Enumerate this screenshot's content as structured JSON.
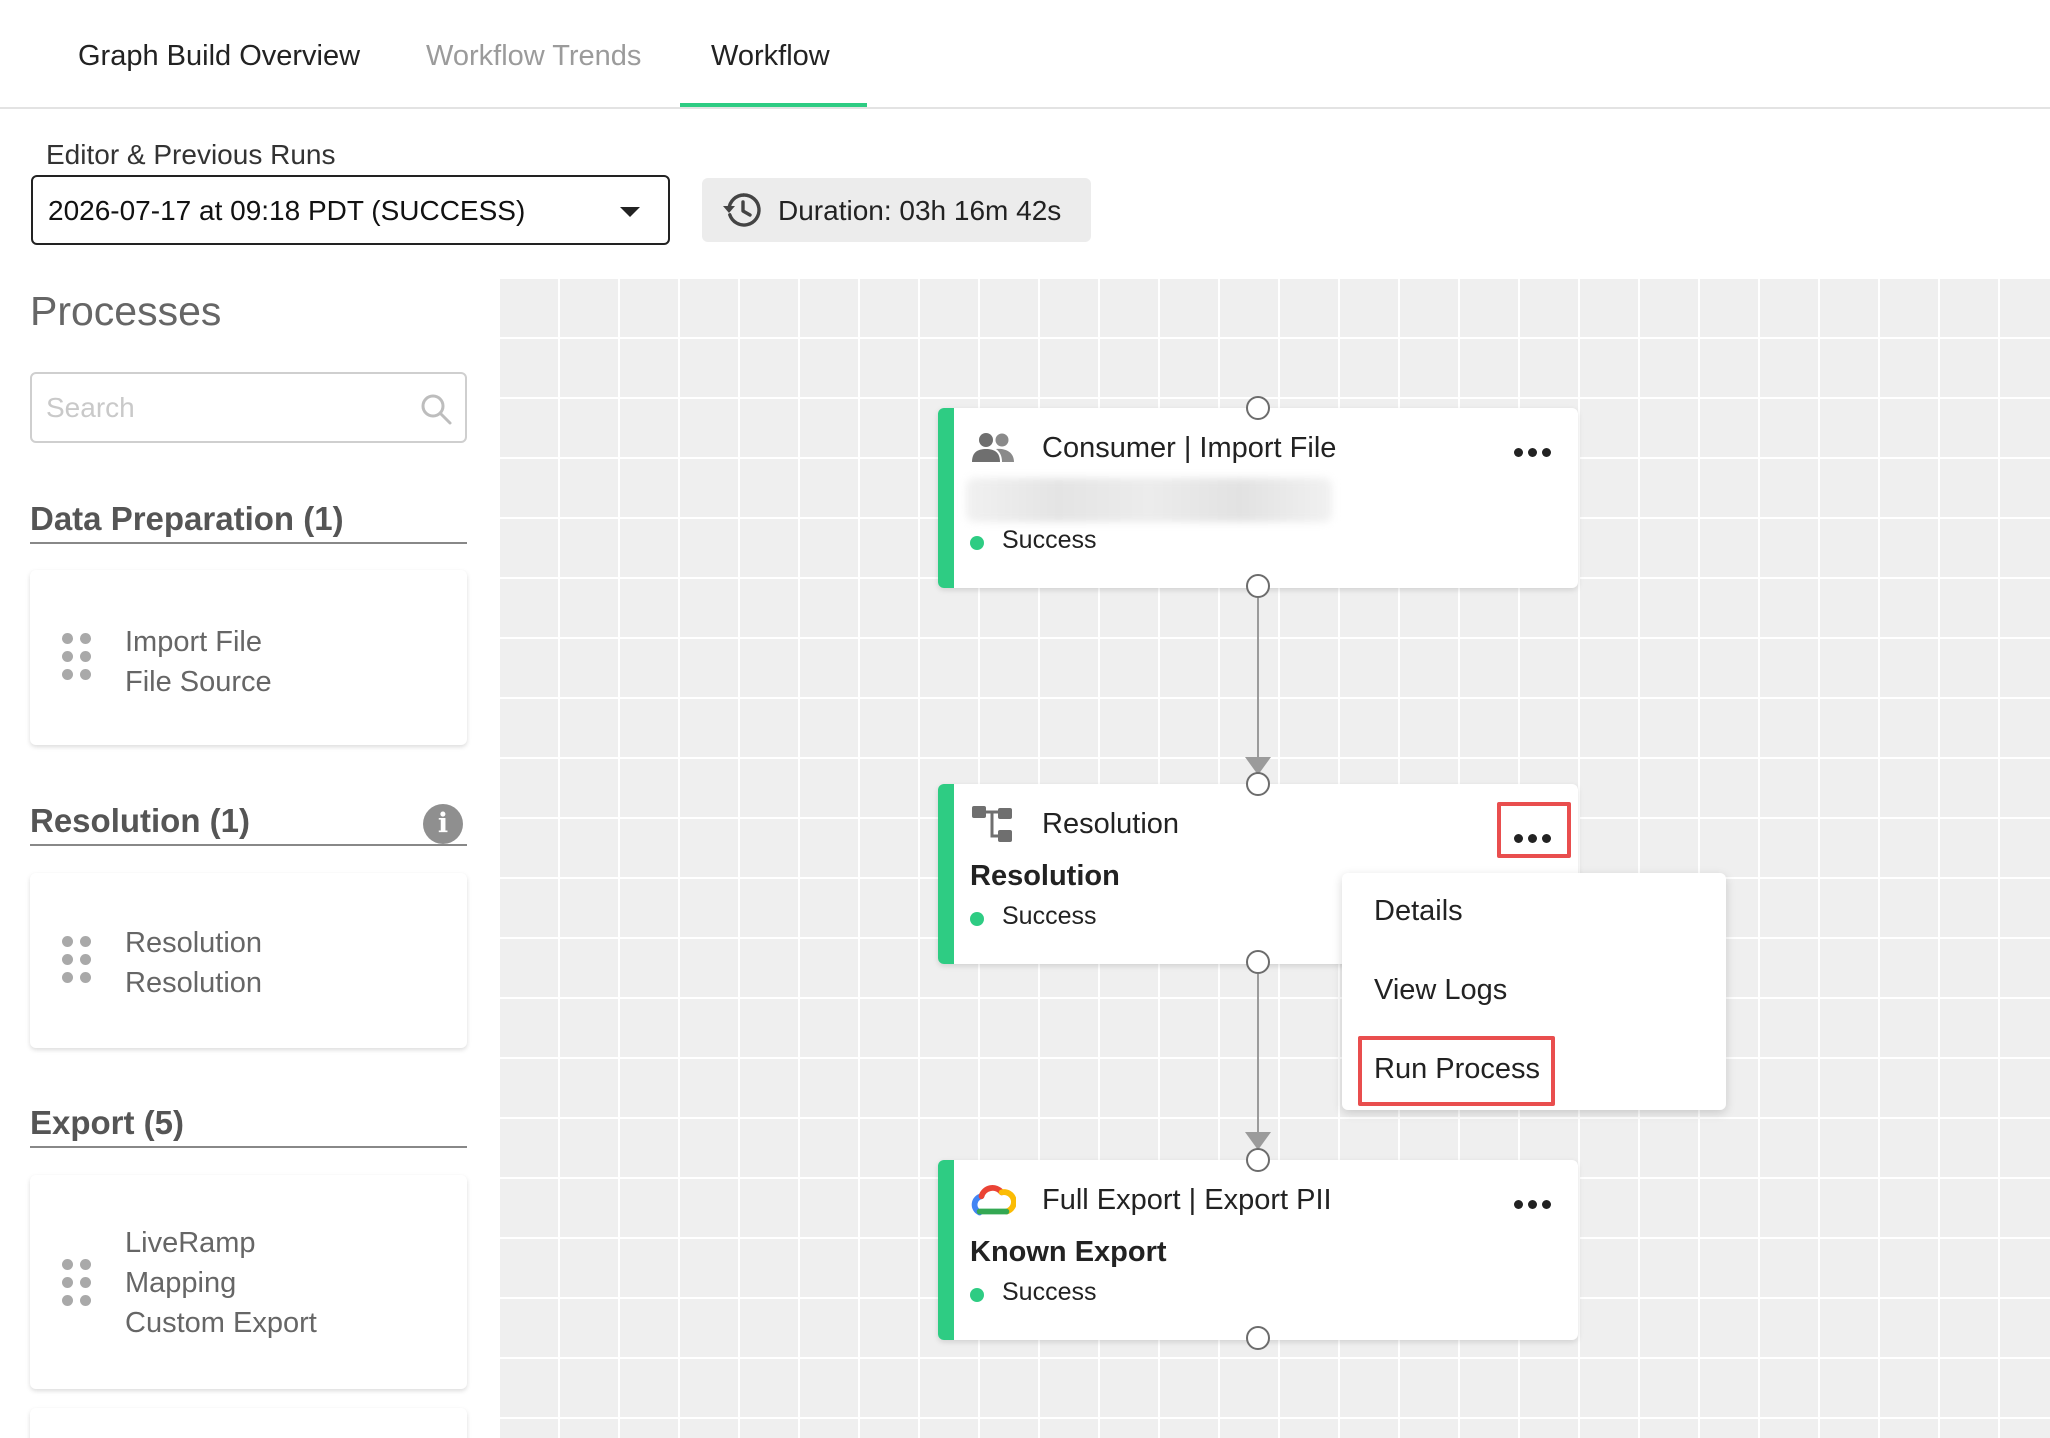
{
  "tabs": [
    {
      "label": "Graph Build Overview",
      "active": false
    },
    {
      "label": "Workflow Trends",
      "active": false
    },
    {
      "label": "Workflow",
      "active": true
    }
  ],
  "toolbar": {
    "run_label": "Editor & Previous Runs",
    "run_selected": "2026-07-17 at 09:18 PDT (SUCCESS)",
    "duration": "Duration: 03h 16m 42s"
  },
  "sidebar": {
    "title": "Processes",
    "search_placeholder": "Search",
    "sections": [
      {
        "title": "Data Preparation (1)",
        "items": [
          [
            "Import File",
            "File Source"
          ]
        ]
      },
      {
        "title": "Resolution (1)",
        "items": [
          [
            "Resolution",
            "Resolution"
          ]
        ]
      },
      {
        "title": "Export (5)",
        "items": [
          [
            "LiveRamp",
            "Mapping",
            "Custom Export"
          ]
        ]
      }
    ]
  },
  "nodes": [
    {
      "icon": "users-icon",
      "title": "Consumer | Import File",
      "subtitle": "",
      "status": "Success"
    },
    {
      "icon": "flow-icon",
      "title": "Resolution",
      "subtitle": "Resolution",
      "status": "Success"
    },
    {
      "icon": "google-cloud-icon",
      "title": "Full Export | Export PII",
      "subtitle": "Known Export",
      "status": "Success"
    }
  ],
  "context_menu": {
    "items": [
      "Details",
      "View Logs",
      "Run Process"
    ]
  },
  "colors": {
    "accent_green": "#2ecc83",
    "highlight_red": "#e94e4e",
    "canvas_bg": "#efefef"
  }
}
